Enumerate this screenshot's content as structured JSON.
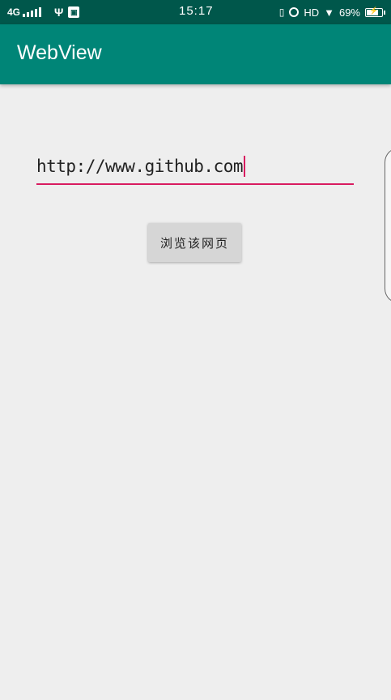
{
  "status_bar": {
    "network": "4G",
    "clock": "15:17",
    "hd_label": "HD",
    "battery": "69%",
    "battery_level": 0.69,
    "icons": [
      "signal-icon",
      "usb-icon",
      "app-notification-icon",
      "vibrate-icon",
      "alarm-icon",
      "wifi-icon",
      "battery-icon"
    ]
  },
  "app_bar": {
    "title": "WebView"
  },
  "main": {
    "url_input": {
      "value": "http://www.github.com"
    },
    "browse_button_label": "浏览该网页"
  },
  "colors": {
    "status_bar": "#00574b",
    "app_bar": "#008577",
    "accent": "#d81b60",
    "background": "#eeeeee",
    "button": "#d6d6d6"
  }
}
